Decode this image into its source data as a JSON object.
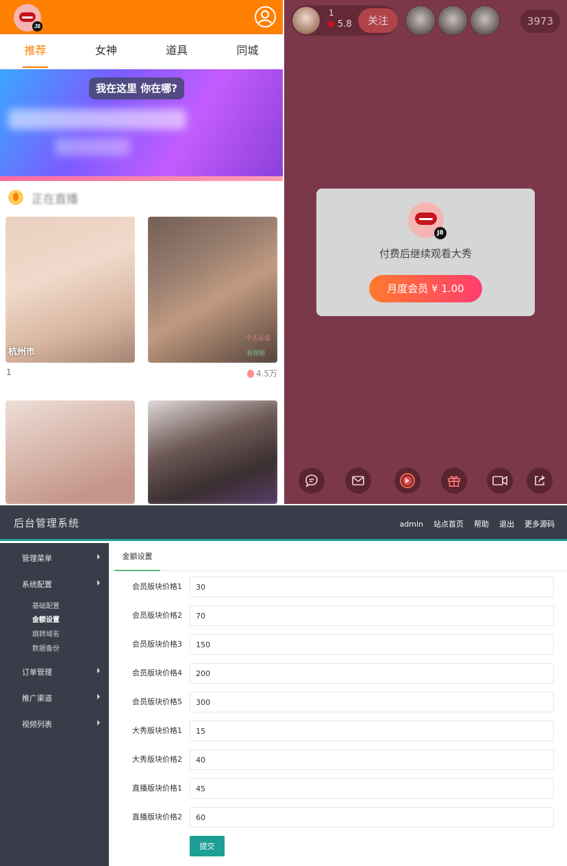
{
  "app": {
    "logo_tag": "J8",
    "tabs": [
      "推荐",
      "女神",
      "道具",
      "同城"
    ],
    "banner_text": "我在这里 你在哪?",
    "section_title": "正在直播",
    "cards": [
      {
        "city": "杭州市",
        "cert": "个人认证",
        "video": "有视频"
      },
      {
        "city": "",
        "cert": "个人认证",
        "video": "有视频"
      }
    ],
    "card1_number": "1",
    "card2_views": "4.5万"
  },
  "live": {
    "host_number": "1",
    "host_hot": "5.8",
    "follow_label": "关注",
    "online_count": "3973",
    "paywall_text": "付费后继续观看大秀",
    "paywall_button": "月度会员 ¥ 1.00",
    "logo_tag": "J8"
  },
  "admin": {
    "title": "后台管理系统",
    "nav": [
      "admin",
      "站点首页",
      "帮助",
      "退出",
      "更多源码"
    ],
    "menu": [
      {
        "label": "管理菜单"
      },
      {
        "label": "系统配置"
      },
      {
        "label": "订单管理"
      },
      {
        "label": "推广渠道"
      },
      {
        "label": "视频列表"
      }
    ],
    "submenu": [
      "基础配置",
      "金额设置",
      "跳转域名",
      "数据备份"
    ],
    "tab": "金额设置",
    "fields": [
      {
        "label": "会员版块价格1",
        "value": "30"
      },
      {
        "label": "会员版块价格2",
        "value": "70"
      },
      {
        "label": "会员版块价格3",
        "value": "150"
      },
      {
        "label": "会员版块价格4",
        "value": "200"
      },
      {
        "label": "会员版块价格5",
        "value": "300"
      },
      {
        "label": "大秀版块价格1",
        "value": "15"
      },
      {
        "label": "大秀版块价格2",
        "value": "40"
      },
      {
        "label": "直播版块价格1",
        "value": "45"
      },
      {
        "label": "直播版块价格2",
        "value": "60"
      }
    ],
    "submit_label": "提交"
  },
  "colors": {
    "app_primary": "#ff7f00",
    "live_bg": "#7a384a",
    "admin_dark": "#393d49",
    "admin_accent": "#1e9f95"
  }
}
